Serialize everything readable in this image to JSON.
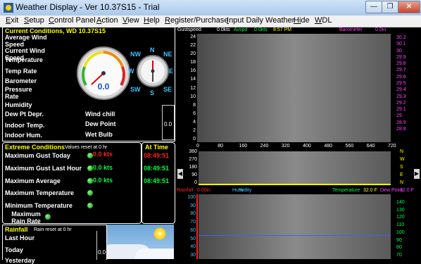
{
  "window": {
    "title": "Weather Display - Ver 10.37S15 - Trial",
    "minimize": "—",
    "restore": "❐",
    "close": "✕"
  },
  "menu": [
    {
      "first": "E",
      "rest": "xit"
    },
    {
      "first": "S",
      "rest": "etup"
    },
    {
      "first": "C",
      "rest": "ontrol Panel"
    },
    {
      "first": "A",
      "rest": "ction"
    },
    {
      "first": "V",
      "rest": "iew"
    },
    {
      "first": "H",
      "rest": "elp"
    },
    {
      "first": "R",
      "rest": "egister/Purchase"
    },
    {
      "first": "I",
      "rest": "nput Daily Weather"
    },
    {
      "first": "Hi",
      "rest": "de"
    },
    {
      "first": "W",
      "rest": "DL"
    }
  ],
  "current": {
    "header": "Current Conditions, WD 10.37S15",
    "labels": {
      "avg_wind": "Average Wind Speed",
      "cur_wind": "Current Wind Speed",
      "temperature": "Temperature",
      "temp_rate": "Temp Rate",
      "barometer": "Barometer",
      "pressure_rate": "Pressure Rate",
      "humidity": "Humidity",
      "dew_depr": "Dew Pt Depr.",
      "indoor_temp": "Indoor Temp.",
      "indoor_hum": "Indoor Hum.",
      "wind_chill": "Wind chill",
      "dew_point": "Dew Point",
      "wet_bulb": "Wet Bulb"
    },
    "gauge_value": "0.0",
    "side_value": "0.0",
    "compass": {
      "N": "N",
      "NE": "NE",
      "E": "E",
      "SE": "SE",
      "S": "S",
      "SW": "SW",
      "W": "W",
      "NW": "NW"
    }
  },
  "extreme": {
    "header": "Extreme Conditions",
    "reset_note": "Values reset at 0 hr",
    "rows": [
      {
        "label": "Maximum Gust Today",
        "value": "0.0 kts",
        "time": "08:49:51"
      },
      {
        "label": "Maximum Gust Last Hour",
        "value": "0.0 kts",
        "time": "08:49:51"
      },
      {
        "label": "Maximum Average",
        "value": "0.0 kts",
        "time": "08:49:51"
      },
      {
        "label": "Maximum Temperature",
        "value": "",
        "time": ""
      },
      {
        "label": "Minimum Temperature",
        "value": "",
        "time": ""
      },
      {
        "label": "Maximum Rain Rate",
        "value": "",
        "time": ""
      }
    ],
    "at_time": "At Time"
  },
  "rainfall": {
    "header": "Rainfall",
    "reset_note": "Rain reset at 0 hr",
    "rows": [
      "Last Hour",
      "Today",
      "Yesterday"
    ],
    "value": "0.0"
  },
  "top_chart": {
    "label_gust": "Gustspeed",
    "gust_value": "0.0kts",
    "label_avg": "Avspd",
    "avg_value": "0.0kts",
    "time": "8:57 PM",
    "label_baro": "Barometer",
    "baro_value": "0.0in",
    "left_ticks": [
      "24",
      "22",
      "20",
      "18",
      "16",
      "14",
      "12",
      "10",
      "8",
      "6",
      "4",
      "2",
      "0"
    ],
    "right_ticks": [
      "30.2",
      "30.1",
      "30",
      "29.9",
      "29.8",
      "29.7",
      "29.6",
      "29.5",
      "29.4",
      "29.3",
      "29.2",
      "29.1",
      "29",
      "28.9",
      "28.8"
    ],
    "bottom_ticks": [
      "0",
      "80",
      "160",
      "240",
      "320",
      "400",
      "480",
      "560",
      "640",
      "720"
    ]
  },
  "dir_chart": {
    "left_ticks": [
      "360",
      "270",
      "180",
      "90",
      "0"
    ],
    "right_ticks": [
      "N",
      "W",
      "S",
      "E",
      "N"
    ]
  },
  "bottom_chart": {
    "label_rain": "Rainfall",
    "rain_value": "0.00in",
    "label_hum": "Humidity",
    "hum_unit": "%",
    "label_temp": "Temperature",
    "temp_value": "32.0 F",
    "label_dew": "Dew Point",
    "dew_value": "32.0 F",
    "left_ticks": [
      "100",
      "90",
      "80",
      "70",
      "60",
      "50",
      "40",
      "30"
    ],
    "right_ticks": [
      "140",
      "130",
      "120",
      "110",
      "100",
      "90",
      "80",
      "70"
    ]
  },
  "colors": {
    "accent": "#ffff00",
    "good": "#00ff40",
    "alert": "#ff2020",
    "baro": "#ff40ff"
  }
}
